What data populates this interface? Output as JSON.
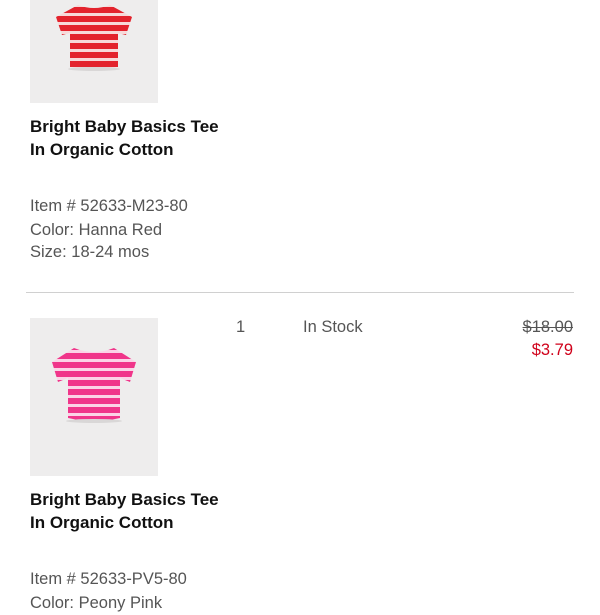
{
  "colors": {
    "sale_price": "#d0021b",
    "divider": "#d0d0d0",
    "thumb_bg": "#eeeded",
    "tee_red": "#e3232d",
    "tee_pink": "#f0358a",
    "stripe": "#f7d9d9"
  },
  "cart_items": [
    {
      "image_icon": "red-striped-tee-image",
      "name": "Bright Baby Basics Tee In Organic Cotton",
      "item_number": "Item # 52633-M23-80",
      "color": "Color: Hanna Red",
      "size": "Size: 18-24 mos"
    },
    {
      "image_icon": "pink-striped-tee-image",
      "name": "Bright Baby Basics Tee In Organic Cotton",
      "item_number": "Item # 52633-PV5-80",
      "color": "Color: Peony Pink",
      "quantity": "1",
      "stock_status": "In Stock",
      "original_price": "$18.00",
      "sale_price": "$3.79"
    }
  ]
}
